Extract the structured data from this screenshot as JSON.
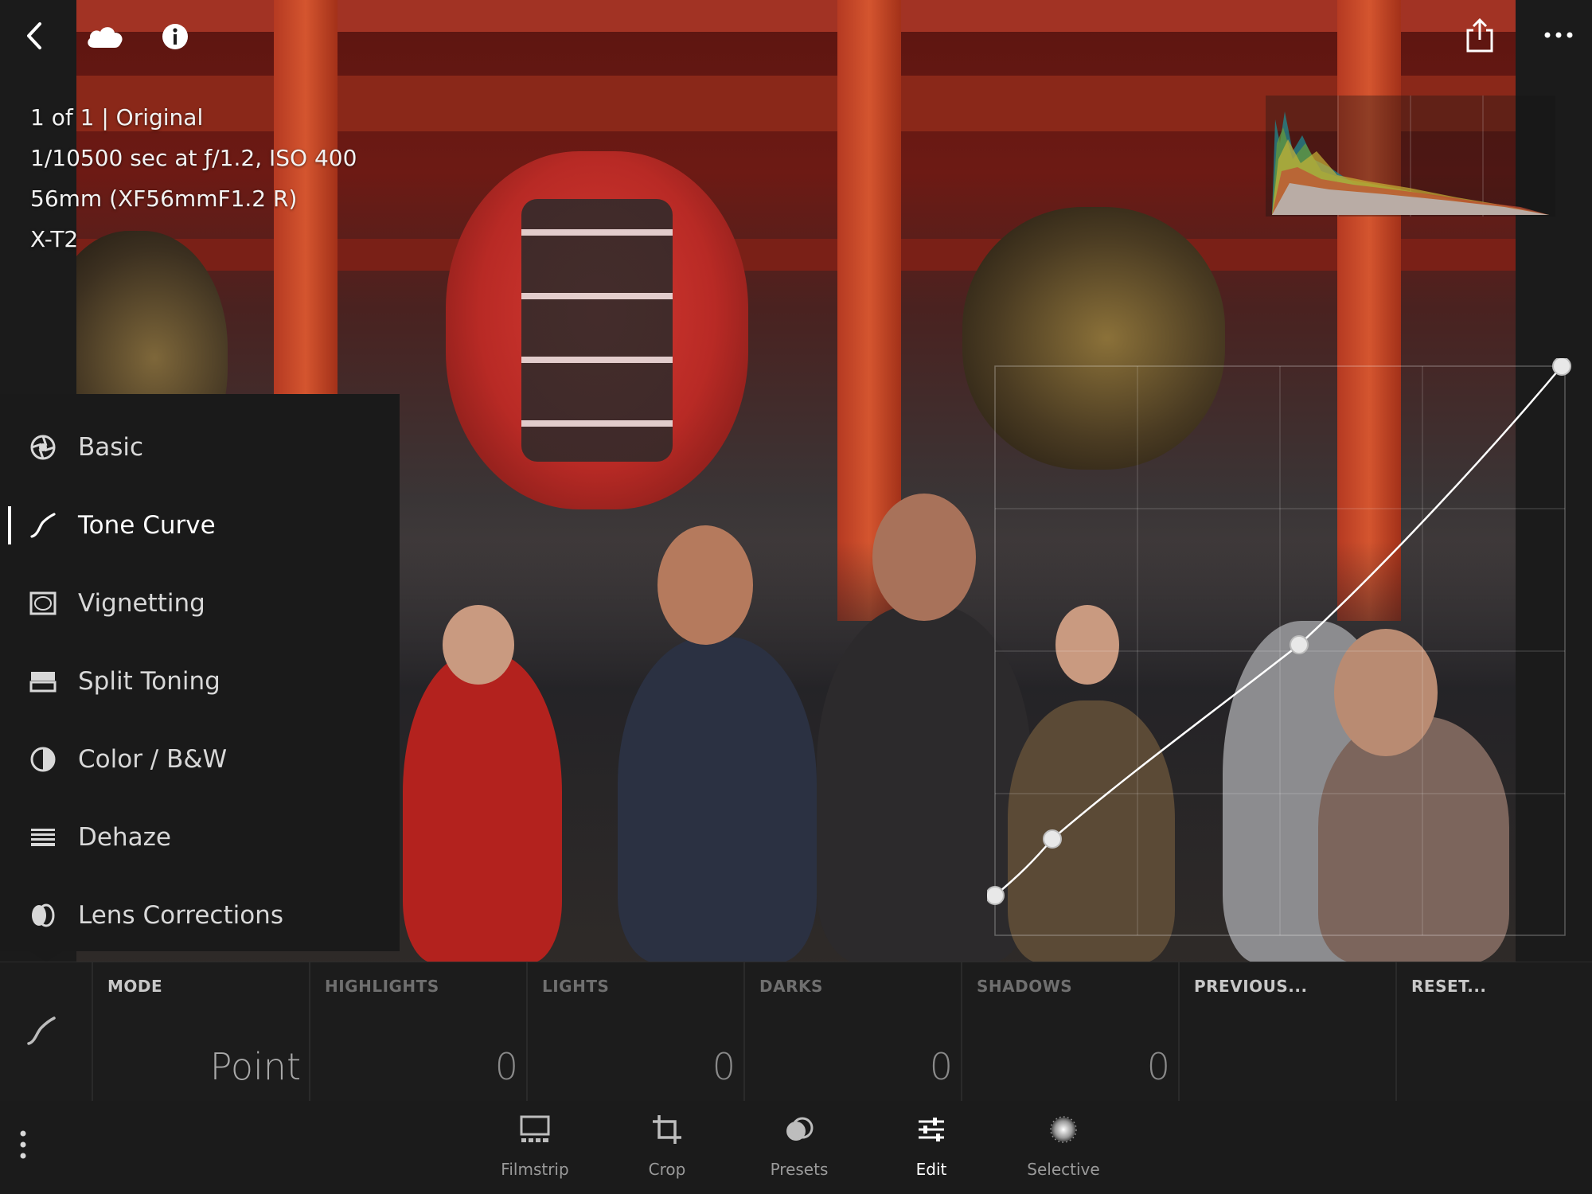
{
  "metadata": {
    "line1": "1 of 1 | Original",
    "line2": "1/10500 sec at ƒ/1.2, ISO 400",
    "line3": "56mm (XF56mmF1.2 R)",
    "line4": "X-T2"
  },
  "top_icons": [
    "back-icon",
    "cloud-icon",
    "info-icon",
    "share-icon",
    "more-icon"
  ],
  "panel_menu": {
    "items": [
      {
        "label": "Basic",
        "icon": "aperture-icon"
      },
      {
        "label": "Tone Curve",
        "icon": "tone-curve-icon",
        "active": true
      },
      {
        "label": "Vignetting",
        "icon": "vignetting-icon"
      },
      {
        "label": "Split Toning",
        "icon": "split-toning-icon"
      },
      {
        "label": "Color / B&W",
        "icon": "color-bw-icon"
      },
      {
        "label": "Dehaze",
        "icon": "dehaze-icon"
      },
      {
        "label": "Lens Corrections",
        "icon": "lens-corrections-icon"
      }
    ]
  },
  "curve_controls": {
    "mode_label": "MODE",
    "mode_value": "Point",
    "highlights_label": "HIGHLIGHTS",
    "highlights_value": "0",
    "lights_label": "LIGHTS",
    "lights_value": "0",
    "darks_label": "DARKS",
    "darks_value": "0",
    "shadows_label": "SHADOWS",
    "shadows_value": "0",
    "previous_label": "PREVIOUS...",
    "reset_label": "RESET..."
  },
  "toolbar": {
    "items": [
      {
        "label": "Filmstrip",
        "icon": "filmstrip-icon"
      },
      {
        "label": "Crop",
        "icon": "crop-icon"
      },
      {
        "label": "Presets",
        "icon": "presets-icon"
      },
      {
        "label": "Edit",
        "icon": "edit-sliders-icon",
        "active": true
      },
      {
        "label": "Selective",
        "icon": "selective-icon"
      }
    ]
  },
  "colors": {
    "background": "#1b1b1b",
    "panel": "#1a1a1a",
    "text_active": "#ffffff",
    "text_muted": "#9a9a9a"
  }
}
